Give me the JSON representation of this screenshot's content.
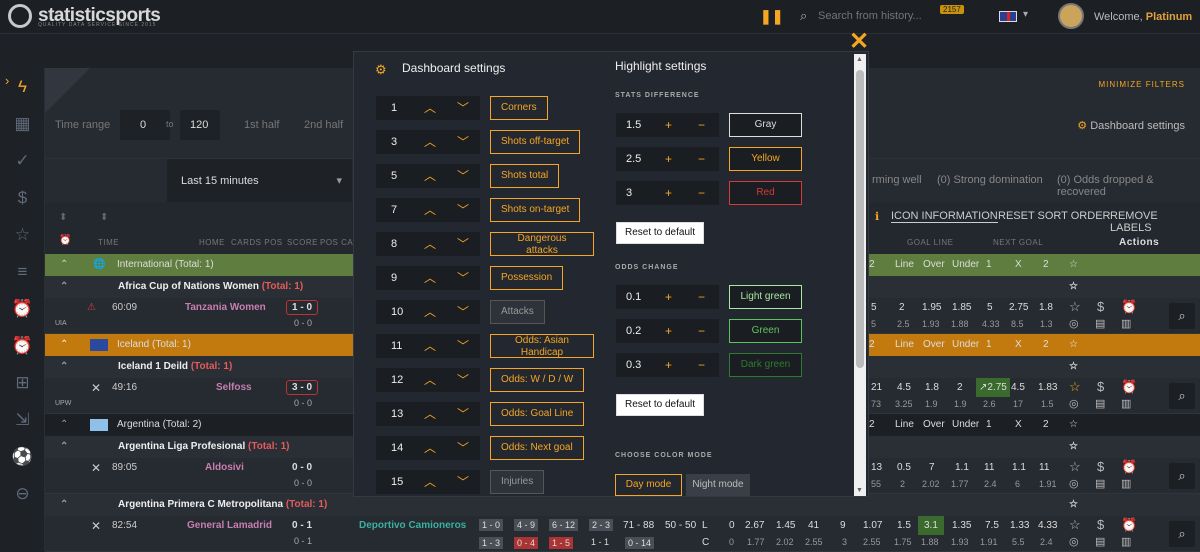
{
  "topbar": {
    "logo": "statisticsports",
    "tagline": "QUALITY DATA SERVICE SINCE 2015",
    "search_placeholder": "Search from history...",
    "badge": "2157",
    "welcome": "Welcome,",
    "user": "Platinum"
  },
  "filters": {
    "minimize": "MINIMIZE FILTERS",
    "time_range": "Time range",
    "from": "0",
    "to_label": "to",
    "to": "120",
    "first_half": "1st half",
    "second_half": "2nd half",
    "dashboard_settings": "Dashboard settings",
    "last_period": "Last 15 minutes",
    "f1": "(0) Strong domination",
    "f2": "(0) Odds dropped & recovered",
    "f0": "rming well"
  },
  "header": {
    "icon_info": "ICON INFORMATION",
    "reset_sort": "RESET SORT ORDER",
    "remove_labels": "REMOVE LABELS",
    "time": "TIME",
    "home": "HOME",
    "cards_pos": "CARDS POS",
    "score": "SCORE",
    "pos_ca": "POS CA",
    "goal_line": "GOAL LINE",
    "next_goal": "NEXT GOAL",
    "actions": "Actions"
  },
  "rows": {
    "c1": "International  (Total: 1)",
    "l1": "Africa Cup of Nations Women",
    "l1t": "(Total: 1)",
    "m1": {
      "t": "60:09",
      "home": "Tanzania Women",
      "score": "1 - 0",
      "ht": "0 - 0",
      "tag": "UIA",
      "n": [
        "5",
        "2",
        "1.95",
        "1.85",
        "5",
        "2.75",
        "1.8"
      ],
      "n2": [
        "5",
        "2.5",
        "1.93",
        "1.88",
        "4.33",
        "8.5",
        "1.3"
      ]
    },
    "c2": "Iceland  (Total: 1)",
    "l2": "Iceland 1 Deild",
    "l2t": "(Total: 1)",
    "m2": {
      "t": "49:16",
      "home": "Selfoss",
      "score": "3 - 0",
      "ht": "0 - 0",
      "tag": "UPW",
      "n": [
        "21",
        "4.5",
        "1.8",
        "2",
        "↗2.75",
        "4.5",
        "1.83"
      ],
      "n2": [
        "73",
        "3.25",
        "1.9",
        "1.9",
        "2.6",
        "17",
        "1.5"
      ]
    },
    "c3": "Argentina  (Total: 2)",
    "l3": "Argentina Liga Profesional",
    "l3t": "(Total: 1)",
    "m3": {
      "t": "89:05",
      "home": "Aldosivi",
      "score": "0 - 0",
      "ht": "0 - 0",
      "n": [
        "13",
        "0.5",
        "7",
        "1.1",
        "11",
        "1.1",
        "11"
      ],
      "n2": [
        "55",
        "2",
        "2.02",
        "1.77",
        "2.4",
        "6",
        "1.91"
      ]
    },
    "l4": "Argentina Primera C Metropolitana",
    "l4t": "(Total: 1)",
    "m4": {
      "t": "82:54",
      "home": "General Lamadrid",
      "score": "0 - 1",
      "ht": "0 - 1",
      "away": "Deportivo Camioneros",
      "s1": "71 - 88",
      "s2": "50 - 50",
      "L": "L",
      "C": "C",
      "n": [
        "0",
        "2.67",
        "1.45",
        "41",
        "9",
        "1.07",
        "1.5",
        "3.1",
        "1.35",
        "7.5",
        "1.33",
        "4.33"
      ],
      "n2": [
        "0",
        "1.77",
        "2.02",
        "2.55",
        "3",
        "2.55",
        "1.75",
        "1.88",
        "1.93",
        "1.91",
        "5.5",
        "2.4"
      ],
      "b": [
        "1 - 0",
        "4 - 9",
        "6 - 12",
        "2 - 3"
      ],
      "b2": [
        "1 - 3",
        "0 - 4",
        "1 - 5",
        "1 - 1",
        "0 - 14"
      ]
    },
    "gl": {
      "line": "Line",
      "over": "Over",
      "under": "Under",
      "one": "1",
      "x": "X",
      "two": "2"
    }
  },
  "modal": {
    "dash_title": "Dashboard settings",
    "hl_title": "Highlight settings",
    "items": [
      {
        "n": "1",
        "label": "Corners",
        "on": true
      },
      {
        "n": "3",
        "label": "Shots off-target",
        "on": true
      },
      {
        "n": "5",
        "label": "Shots total",
        "on": true
      },
      {
        "n": "7",
        "label": "Shots on-target",
        "on": true
      },
      {
        "n": "8",
        "label": "Dangerous attacks",
        "on": true
      },
      {
        "n": "9",
        "label": "Possession",
        "on": true
      },
      {
        "n": "10",
        "label": "Attacks",
        "on": false
      },
      {
        "n": "11",
        "label": "Odds: Asian Handicap",
        "on": true
      },
      {
        "n": "12",
        "label": "Odds: W / D / W",
        "on": true
      },
      {
        "n": "13",
        "label": "Odds: Goal Line",
        "on": true
      },
      {
        "n": "14",
        "label": "Odds: Next goal",
        "on": true
      },
      {
        "n": "15",
        "label": "Injuries",
        "on": false
      }
    ],
    "stats_diff": "STATS DIFFERENCE",
    "odds_change": "ODDS CHANGE",
    "color_mode": "CHOOSE COLOR MODE",
    "sd": [
      {
        "v": "1.5",
        "c": "Gray",
        "col": "#dddddd"
      },
      {
        "v": "2.5",
        "c": "Yellow",
        "col": "#f5a623"
      },
      {
        "v": "3",
        "c": "Red",
        "col": "#d33b3b"
      }
    ],
    "oc": [
      {
        "v": "0.1",
        "c": "Light green",
        "col": "#a8e6a1"
      },
      {
        "v": "0.2",
        "c": "Green",
        "col": "#5cc45c"
      },
      {
        "v": "0.3",
        "c": "Dark green",
        "col": "#2f7a2f"
      }
    ],
    "plus": "+",
    "minus": "−",
    "reset": "Reset to default",
    "day": "Day mode",
    "night": "Night mode"
  }
}
